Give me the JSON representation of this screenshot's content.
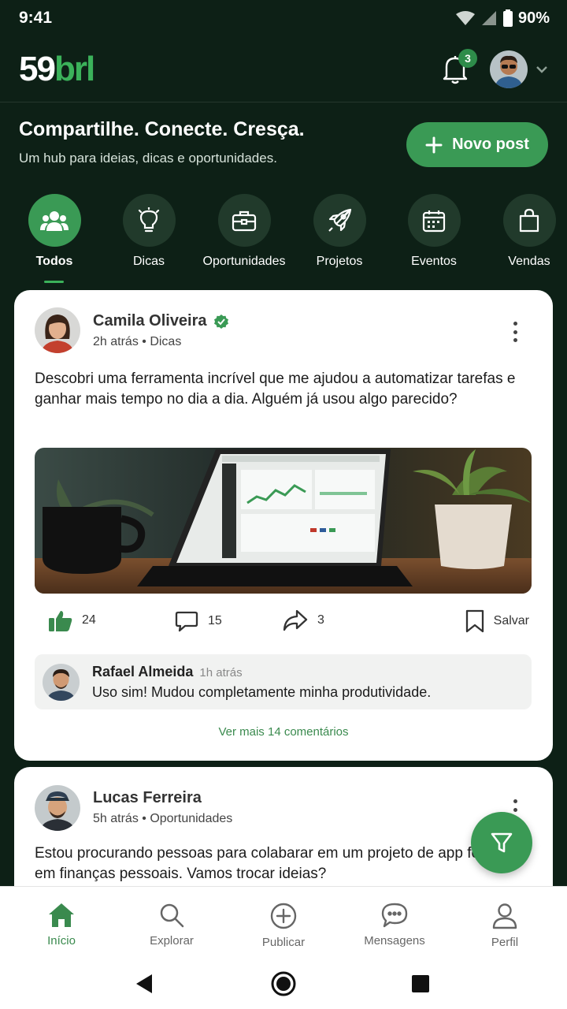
{
  "status_bar": {
    "time": "9:41",
    "battery": "90%"
  },
  "header": {
    "logo_main": "59",
    "logo_accent": "brl",
    "notification_count": "3"
  },
  "hero": {
    "title": "Compartilhe. Conecte. Cresça.",
    "subtitle": "Um hub para ideias, dicas e oportunidades.",
    "new_post_label": "Novo post"
  },
  "categories": [
    {
      "label": "Todos",
      "icon": "users-icon",
      "active": true
    },
    {
      "label": "Dicas",
      "icon": "lightbulb-icon"
    },
    {
      "label": "Oportunidades",
      "icon": "briefcase-icon"
    },
    {
      "label": "Projetos",
      "icon": "rocket-icon"
    },
    {
      "label": "Eventos",
      "icon": "calendar-icon"
    },
    {
      "label": "Vendas",
      "icon": "shopping-bag-icon"
    }
  ],
  "posts": [
    {
      "author": "Camila Oliveira",
      "verified": true,
      "time": "2h atrás",
      "category": "Dicas",
      "text": "Descobri uma ferramenta incrível que me ajudou a automatizar tarefas e ganhar mais tempo no dia a dia. Alguém já usou algo parecido?",
      "likes": "24",
      "comments": "15",
      "shares": "3",
      "save_label": "Salvar",
      "top_comment": {
        "author": "Rafael Almeida",
        "time": "1h atrás",
        "text": "Uso sim! Mudou completamente minha produtividade."
      },
      "see_more": "Ver mais 14 comentários"
    },
    {
      "author": "Lucas Ferreira",
      "time": "5h atrás",
      "category": "Oportunidades",
      "text": "Estou procurando pessoas para colabarar em um projeto de app focado em finanças pessoais. Vamos trocar ideias?"
    }
  ],
  "bottom_nav": [
    {
      "label": "Início",
      "icon": "home-icon",
      "active": true
    },
    {
      "label": "Explorar",
      "icon": "search-icon"
    },
    {
      "label": "Publicar",
      "icon": "plus-circle-icon"
    },
    {
      "label": "Mensagens",
      "icon": "chat-icon"
    },
    {
      "label": "Perfil",
      "icon": "user-icon"
    }
  ],
  "colors": {
    "background": "#0d2016",
    "accent": "#3a9a55",
    "accent_text": "#3a8a4e",
    "card": "#ffffff"
  }
}
